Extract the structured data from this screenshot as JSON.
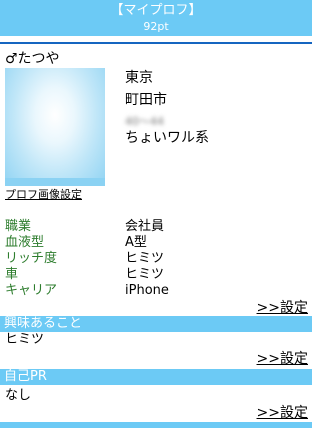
{
  "header": {
    "title": "【マイプロフ】",
    "points": "92pt"
  },
  "profile": {
    "name": "♂たつや",
    "photo_link": "プロフ画像設定",
    "location": {
      "prefecture": "東京",
      "city": "町田市",
      "age_blur": "40〜44",
      "style": "ちょいワル系"
    }
  },
  "details": [
    {
      "label": "職業",
      "value": "会社員"
    },
    {
      "label": "血液型",
      "value": "A型"
    },
    {
      "label": "リッチ度",
      "value": "ヒミツ"
    },
    {
      "label": "車",
      "value": "ヒミツ"
    },
    {
      "label": "キャリア",
      "value": "iPhone"
    }
  ],
  "edit_label": ">>設定",
  "sections": {
    "interests": {
      "title": "興味あること",
      "value": "ヒミツ"
    },
    "pr": {
      "title": "自己PR",
      "value": "なし"
    },
    "next_partial": {
      "title": "…"
    }
  },
  "colors": {
    "accent": "#6ccaf5",
    "divider": "#1565c0",
    "label_green": "#2e7d2e"
  }
}
